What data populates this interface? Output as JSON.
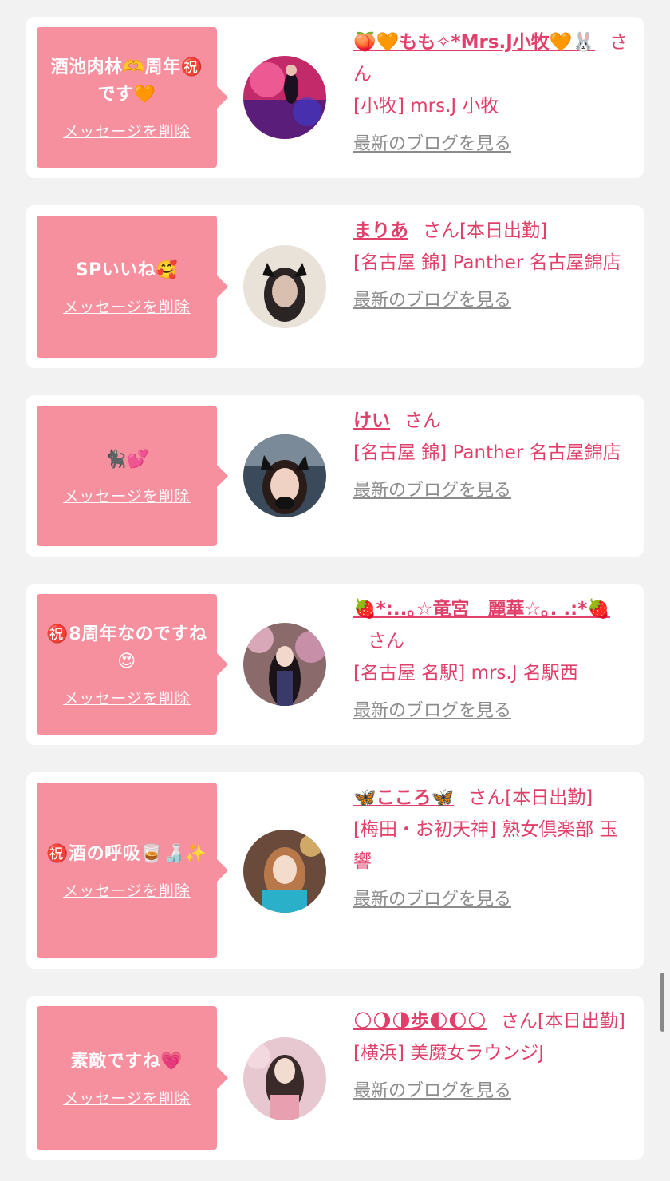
{
  "delete_label": "メッセージを削除",
  "blog_label": "最新のブログを見る",
  "san_label": "さん",
  "colors": {
    "bubble": "#f7909e",
    "accent": "#e0406a",
    "link_gray": "#8c8c8c"
  },
  "messages": [
    {
      "text": "酒池肉林🫶周年㊗️です🧡",
      "name": "🍑🧡もも✧*Mrs.J小牧🧡🐰",
      "status": "",
      "shop": "[小牧] mrs.J 小牧",
      "avatar_icon": "avatar-photo"
    },
    {
      "text": "SPいいね🥰",
      "name": "まりあ",
      "status": "[本日出勤]",
      "shop": "[名古屋 錦] Panther 名古屋錦店",
      "avatar_icon": "avatar-photo"
    },
    {
      "text": "🐈‍⬛💕",
      "name": "けい",
      "status": "",
      "shop": "[名古屋 錦] Panther 名古屋錦店",
      "avatar_icon": "avatar-photo"
    },
    {
      "text": "㊗️8周年なのですね😍",
      "name": "🍓*:..｡☆竜宮　麗華☆｡. .:*🍓",
      "status": "",
      "shop": "[名古屋 名駅] mrs.J 名駅西",
      "avatar_icon": "avatar-photo"
    },
    {
      "text": "㊗️酒の呼吸🥃🍶✨",
      "name": "🦋こころ🦋",
      "status": "[本日出勤]",
      "shop": "[梅田・お初天神] 熟女倶楽部 玉響",
      "avatar_icon": "avatar-photo"
    },
    {
      "text": "素敵ですね💗",
      "name": "🌕🌖🌗歩🌓🌔🌕",
      "status": "[本日出勤]",
      "shop": "[横浜] 美魔女ラウンジJ",
      "avatar_icon": "avatar-photo"
    }
  ]
}
